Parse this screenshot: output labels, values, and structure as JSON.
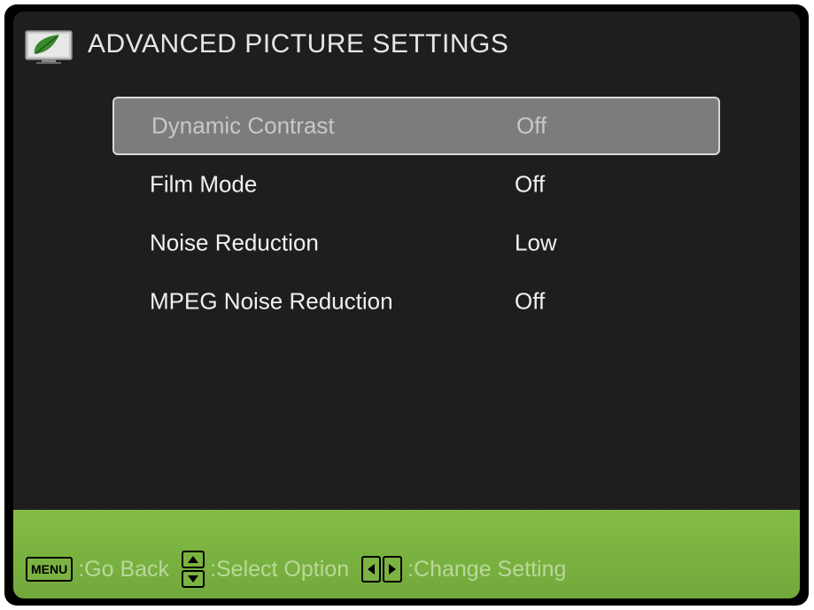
{
  "header": {
    "title": "ADVANCED PICTURE SETTINGS",
    "icon": "picture-settings-icon"
  },
  "menu": {
    "selected_index": 0,
    "items": [
      {
        "label": "Dynamic Contrast",
        "value": "Off"
      },
      {
        "label": "Film Mode",
        "value": "Off"
      },
      {
        "label": "Noise Reduction",
        "value": "Low"
      },
      {
        "label": "MPEG Noise Reduction",
        "value": "Off"
      }
    ]
  },
  "footer": {
    "menu_key_label": "MENU",
    "go_back": ":Go Back",
    "select_option": ":Select Option",
    "change_setting": ":Change Setting"
  },
  "colors": {
    "background": "#1e1e1e",
    "footer": "#7bb342",
    "selected_row": "#7c7c7c",
    "text": "#f0f0f0"
  }
}
